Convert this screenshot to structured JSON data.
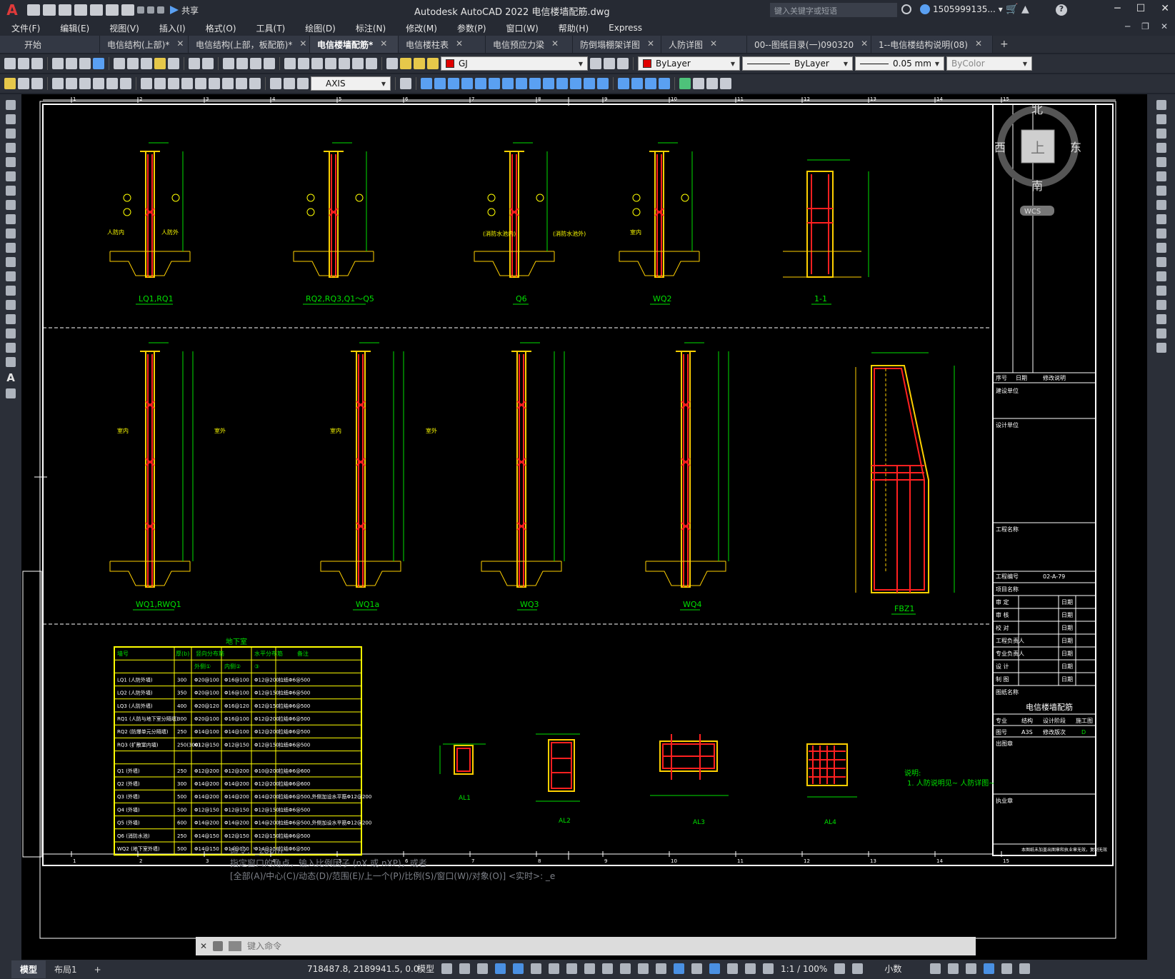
{
  "app": {
    "logo": "A",
    "title": "Autodesk AutoCAD 2022    电信楼墙配筋.dwg",
    "share_label": "共享",
    "search_placeholder": "键入关键字或短语",
    "user": "1505999135...",
    "help": "?"
  },
  "menu": [
    "文件(F)",
    "编辑(E)",
    "视图(V)",
    "插入(I)",
    "格式(O)",
    "工具(T)",
    "绘图(D)",
    "标注(N)",
    "修改(M)",
    "参数(P)",
    "窗口(W)",
    "帮助(H)",
    "Express"
  ],
  "tabs": [
    {
      "label": "开始",
      "closable": false,
      "active": false
    },
    {
      "label": "电信结构(上部)*",
      "closable": true,
      "active": false
    },
    {
      "label": "电信结构(上部，板配筋)*",
      "closable": true,
      "active": false
    },
    {
      "label": "电信楼墙配筋*",
      "closable": true,
      "active": true
    },
    {
      "label": "电信楼柱表",
      "closable": true,
      "active": false
    },
    {
      "label": "电信预应力梁",
      "closable": true,
      "active": false
    },
    {
      "label": "防倒塌棚架详图",
      "closable": true,
      "active": false
    },
    {
      "label": "人防详图",
      "closable": true,
      "active": false
    },
    {
      "label": "00--图纸目录(一)090320",
      "closable": true,
      "active": false
    },
    {
      "label": "1--电信楼结构说明(08)",
      "closable": true,
      "active": false
    }
  ],
  "properties": {
    "layer": "GJ",
    "color": "ByLayer",
    "linetype": "ByLayer",
    "lineweight": "0.05 mm",
    "plotstyle": "ByColor",
    "dimstyle": "AXIS"
  },
  "viewcube": {
    "north": "北",
    "south": "南",
    "east": "东",
    "west": "西",
    "top": "上",
    "ucs": "WCS"
  },
  "drawing": {
    "walls_row1": [
      "LQ1,RQ1",
      "RQ2,RQ3,Q1～Q5",
      "Q6",
      "WQ2",
      "1-1"
    ],
    "walls_row2": [
      "WQ1,RWQ1",
      "WQ1a",
      "WQ3",
      "WQ4",
      "FBZ1"
    ],
    "details": [
      "AL1",
      "AL2",
      "AL3",
      "AL4"
    ],
    "labels_inner": [
      "人防内",
      "人防外",
      "室内",
      "室外",
      "(消防水池内)",
      "(消防水池外)"
    ],
    "note_title": "说明:",
    "note_text": "1. 人防说明见~ 人防详图~",
    "table": {
      "title": "地下室",
      "headers": [
        "墙号",
        "厚(b)",
        "竖向分布筋",
        "",
        "水平分布筋",
        "备注"
      ],
      "subheaders": [
        "",
        "",
        "外侧①",
        "内侧②",
        "③",
        ""
      ],
      "rows": [
        [
          "LQ1 (人防外墙)",
          "300",
          "Φ20@100",
          "Φ16@100",
          "Φ12@200",
          "拉结Φ6@500"
        ],
        [
          "LQ2 (人防外墙)",
          "350",
          "Φ20@100",
          "Φ16@100",
          "Φ12@150",
          "拉结Φ6@500"
        ],
        [
          "LQ3 (人防外墙)",
          "400",
          "Φ20@120",
          "Φ16@120",
          "Φ12@150",
          "拉结Φ6@500"
        ],
        [
          "RQ1 (人防与地下室分隔墙)",
          "300",
          "Φ20@100",
          "Φ16@100",
          "Φ12@200",
          "拉结Φ6@500"
        ],
        [
          "RQ2 (防爆单元分隔墙)",
          "250",
          "Φ14@100",
          "Φ14@100",
          "Φ12@200",
          "拉结Φ6@500"
        ],
        [
          "RQ3 (扩散室内墙)",
          "250(300)",
          "Φ12@150",
          "Φ12@150",
          "Φ12@150",
          "拉结Φ6@500"
        ],
        [
          "",
          "",
          "",
          "",
          "",
          ""
        ],
        [
          "Q1 (外墙)",
          "250",
          "Φ12@200",
          "Φ12@200",
          "Φ10@200",
          "拉结Φ6@600"
        ],
        [
          "Q2 (外墙)",
          "300",
          "Φ14@200",
          "Φ14@200",
          "Φ12@200",
          "拉结Φ6@600"
        ],
        [
          "Q3 (外墙)",
          "500",
          "Φ14@200",
          "Φ14@200",
          "Φ14@200",
          "拉结Φ6@500,外侧加设水平筋Φ12@200"
        ],
        [
          "Q4 (外墙)",
          "500",
          "Φ12@150",
          "Φ12@150",
          "Φ12@150",
          "拉结Φ6@500"
        ],
        [
          "Q5 (外墙)",
          "600",
          "Φ14@200",
          "Φ14@200",
          "Φ14@200",
          "拉结Φ6@500,外侧加设水平筋Φ12@200"
        ],
        [
          "Q6 (消防水池)",
          "250",
          "Φ14@150",
          "Φ12@150",
          "Φ12@150",
          "拉结Φ6@500"
        ],
        [
          "WQ2 (地下室外墙)",
          "500",
          "Φ14@150",
          "Φ14@150",
          "Φ14@150",
          "拉结Φ6@500"
        ]
      ]
    },
    "title_block": {
      "revision_hdr": [
        "序号",
        "日期",
        "修改说明"
      ],
      "design_unit": "建设单位",
      "design_by": "设计单位",
      "project_name": "工程名称",
      "project_no_label": "工程编号",
      "project_no": "02-A-79",
      "item": "项目名称",
      "roles": [
        "审  定",
        "审  核",
        "校  对",
        "工程负责人",
        "专业负责人",
        "设  计",
        "制  图"
      ],
      "date_label": "日期",
      "drawing_name_label": "图纸名称",
      "drawing_name": "电信楼墙配筋",
      "spec_labels": [
        "专业",
        "结构",
        "设计阶段",
        "施工图"
      ],
      "sheet_labels": [
        "图号",
        "A3S",
        "修改版次",
        "D"
      ],
      "stamp": "出图章",
      "reg_stamp": "执业章",
      "footer": "本图纸未加盖出图章和执业章无效，复制无效"
    },
    "dims_top_axis": [
      "1",
      "2",
      "3",
      "4",
      "5",
      "6",
      "7",
      "8",
      "9",
      "10",
      "11",
      "12",
      "13",
      "14",
      "15"
    ]
  },
  "command": {
    "history": [
      "命令: '_zoom",
      "指定窗口的角点，输入比例因子 (nX 或 nXP)，或者",
      "[全部(A)/中心(C)/动态(D)/范围(E)/上一个(P)/比例(S)/窗口(W)/对象(O)] <实时>: _e"
    ],
    "placeholder": "键入命令"
  },
  "status": {
    "layouts": [
      {
        "label": "模型",
        "active": true
      },
      {
        "label": "布局1",
        "active": false
      }
    ],
    "add_layout": "+",
    "coords": "718487.8, 2189941.5, 0.0",
    "space": "模型",
    "scale": "1:1 / 100%",
    "units": "小数"
  },
  "colors": {
    "accent": "#4a90e2",
    "drawing_bg": "#000000",
    "rebar": "#ff2020",
    "wall": "#ffd000",
    "dim": "#00e000",
    "text": "#ffff00",
    "frame": "#ffffff"
  }
}
